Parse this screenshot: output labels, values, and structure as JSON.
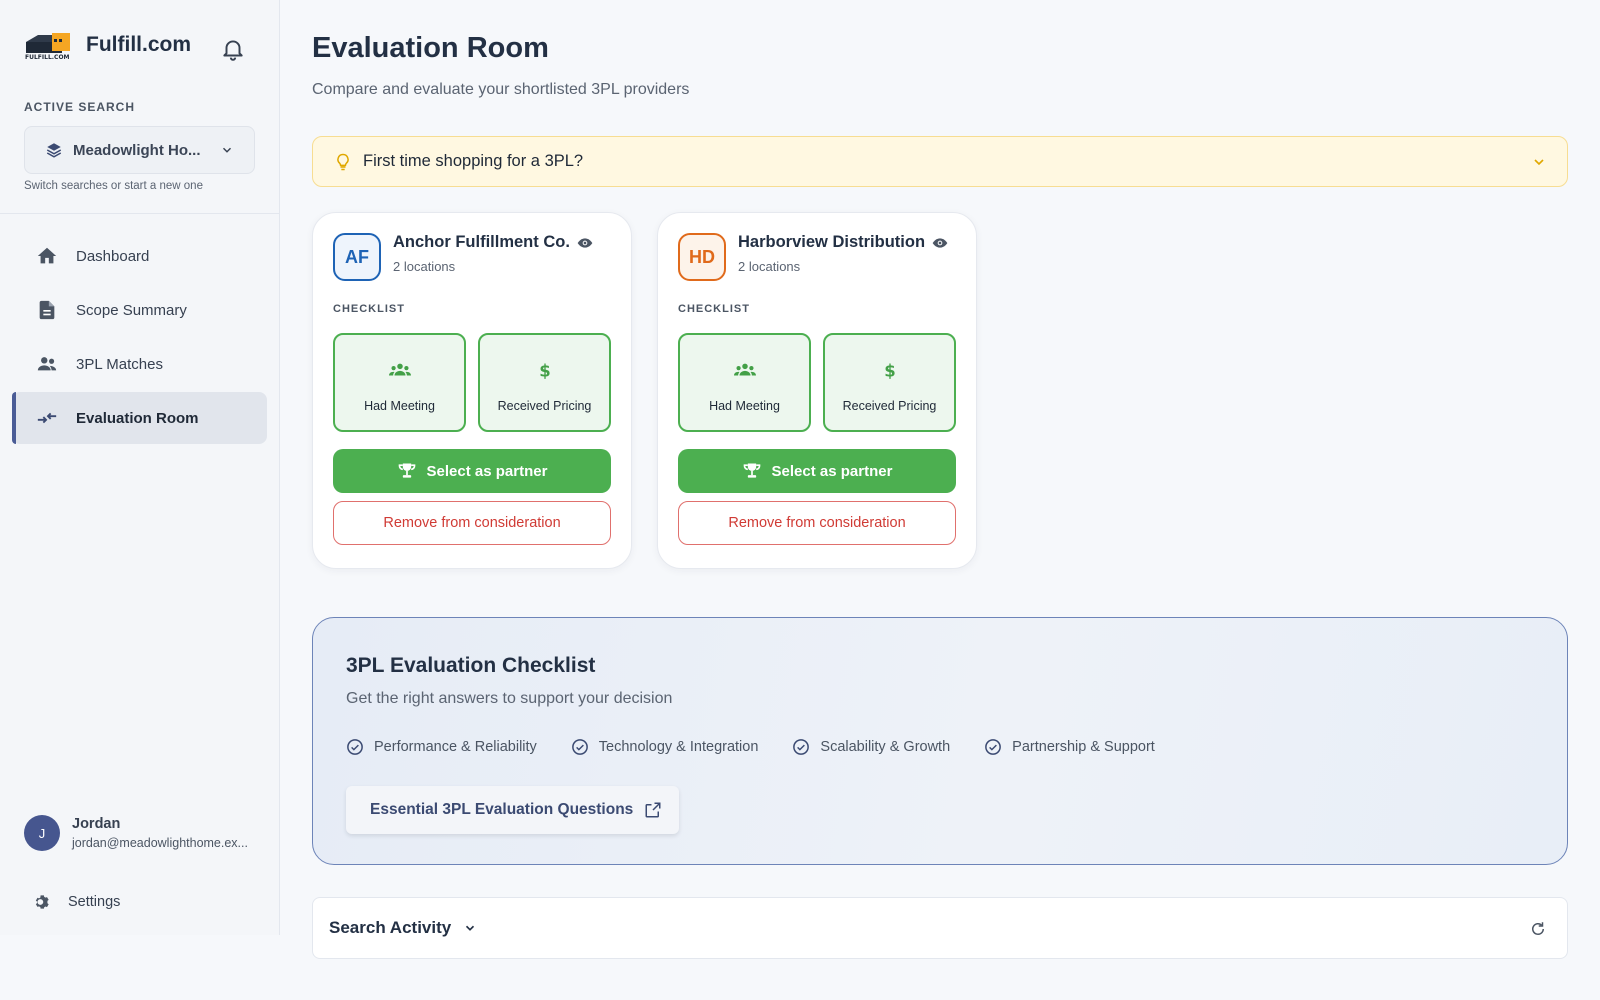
{
  "sidebar": {
    "brand": "Fulfill.com",
    "logo_text": "FULFILL.COM",
    "active_search_label": "ACTIVE SEARCH",
    "active_search_value": "Meadowlight Ho...",
    "switch_hint": "Switch searches or start a new one",
    "nav": [
      {
        "label": "Dashboard",
        "icon": "home-icon",
        "active": false
      },
      {
        "label": "Scope Summary",
        "icon": "document-icon",
        "active": false
      },
      {
        "label": "3PL Matches",
        "icon": "people-icon",
        "active": false
      },
      {
        "label": "Evaluation Room",
        "icon": "compare-arrows-icon",
        "active": true
      }
    ],
    "user": {
      "initial": "J",
      "name": "Jordan",
      "email": "jordan@meadowlighthome.ex..."
    },
    "settings_label": "Settings"
  },
  "main": {
    "title": "Evaluation Room",
    "subtitle": "Compare and evaluate your shortlisted 3PL providers",
    "tip": "First time shopping for a 3PL?"
  },
  "providers": [
    {
      "initials": "AF",
      "name": "Anchor Fulfillment Co.",
      "locations": "2 locations",
      "badge_color": "#1e63b5",
      "badge_bg": "#eef4fc",
      "checklist_label": "CHECKLIST",
      "tiles": [
        "Had Meeting",
        "Received Pricing"
      ],
      "select_label": "Select as partner",
      "remove_label": "Remove from consideration"
    },
    {
      "initials": "HD",
      "name": "Harborview Distribution",
      "locations": "2 locations",
      "badge_color": "#e06a1b",
      "badge_bg": "#fdf3ea",
      "checklist_label": "CHECKLIST",
      "tiles": [
        "Had Meeting",
        "Received Pricing"
      ],
      "select_label": "Select as partner",
      "remove_label": "Remove from consideration"
    }
  ],
  "checklist": {
    "title": "3PL Evaluation Checklist",
    "subtitle": "Get the right answers to support your decision",
    "items": [
      "Performance & Reliability",
      "Technology & Integration",
      "Scalability & Growth",
      "Partnership & Support"
    ],
    "link_label": "Essential 3PL Evaluation Questions"
  },
  "activity": {
    "label": "Search Activity"
  },
  "colors": {
    "accent_green": "#4caf50",
    "danger_red": "#d03b35",
    "nav_accent": "#4a5c96"
  }
}
